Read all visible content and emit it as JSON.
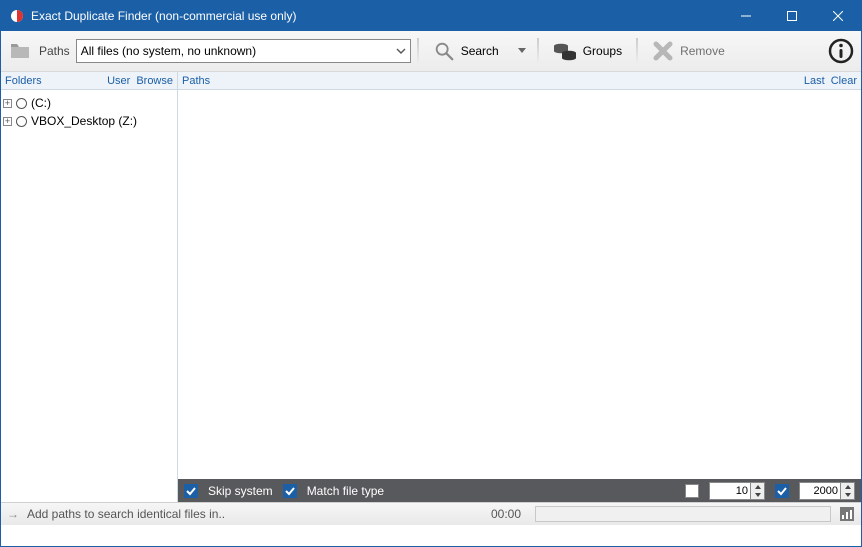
{
  "window": {
    "title": "Exact Duplicate Finder (non-commercial use only)"
  },
  "toolbar": {
    "paths_label": "Paths",
    "combo_value": "All files (no system, no unknown)",
    "search_label": "Search",
    "groups_label": "Groups",
    "remove_label": "Remove"
  },
  "left_panel": {
    "title": "Folders",
    "link_user": "User",
    "link_browse": "Browse",
    "drives": [
      {
        "label": "(C:)"
      },
      {
        "label": "VBOX_Desktop (Z:)"
      }
    ]
  },
  "right_panel": {
    "title": "Paths",
    "link_last": "Last",
    "link_clear": "Clear"
  },
  "filterbar": {
    "skip_system_checked": true,
    "skip_system_label": "Skip system",
    "match_type_checked": true,
    "match_type_label": "Match file type",
    "min_checked": false,
    "min_value": "10",
    "max_checked": true,
    "max_value": "2000"
  },
  "status": {
    "hint": "Add paths to search identical files in..",
    "time": "00:00"
  }
}
